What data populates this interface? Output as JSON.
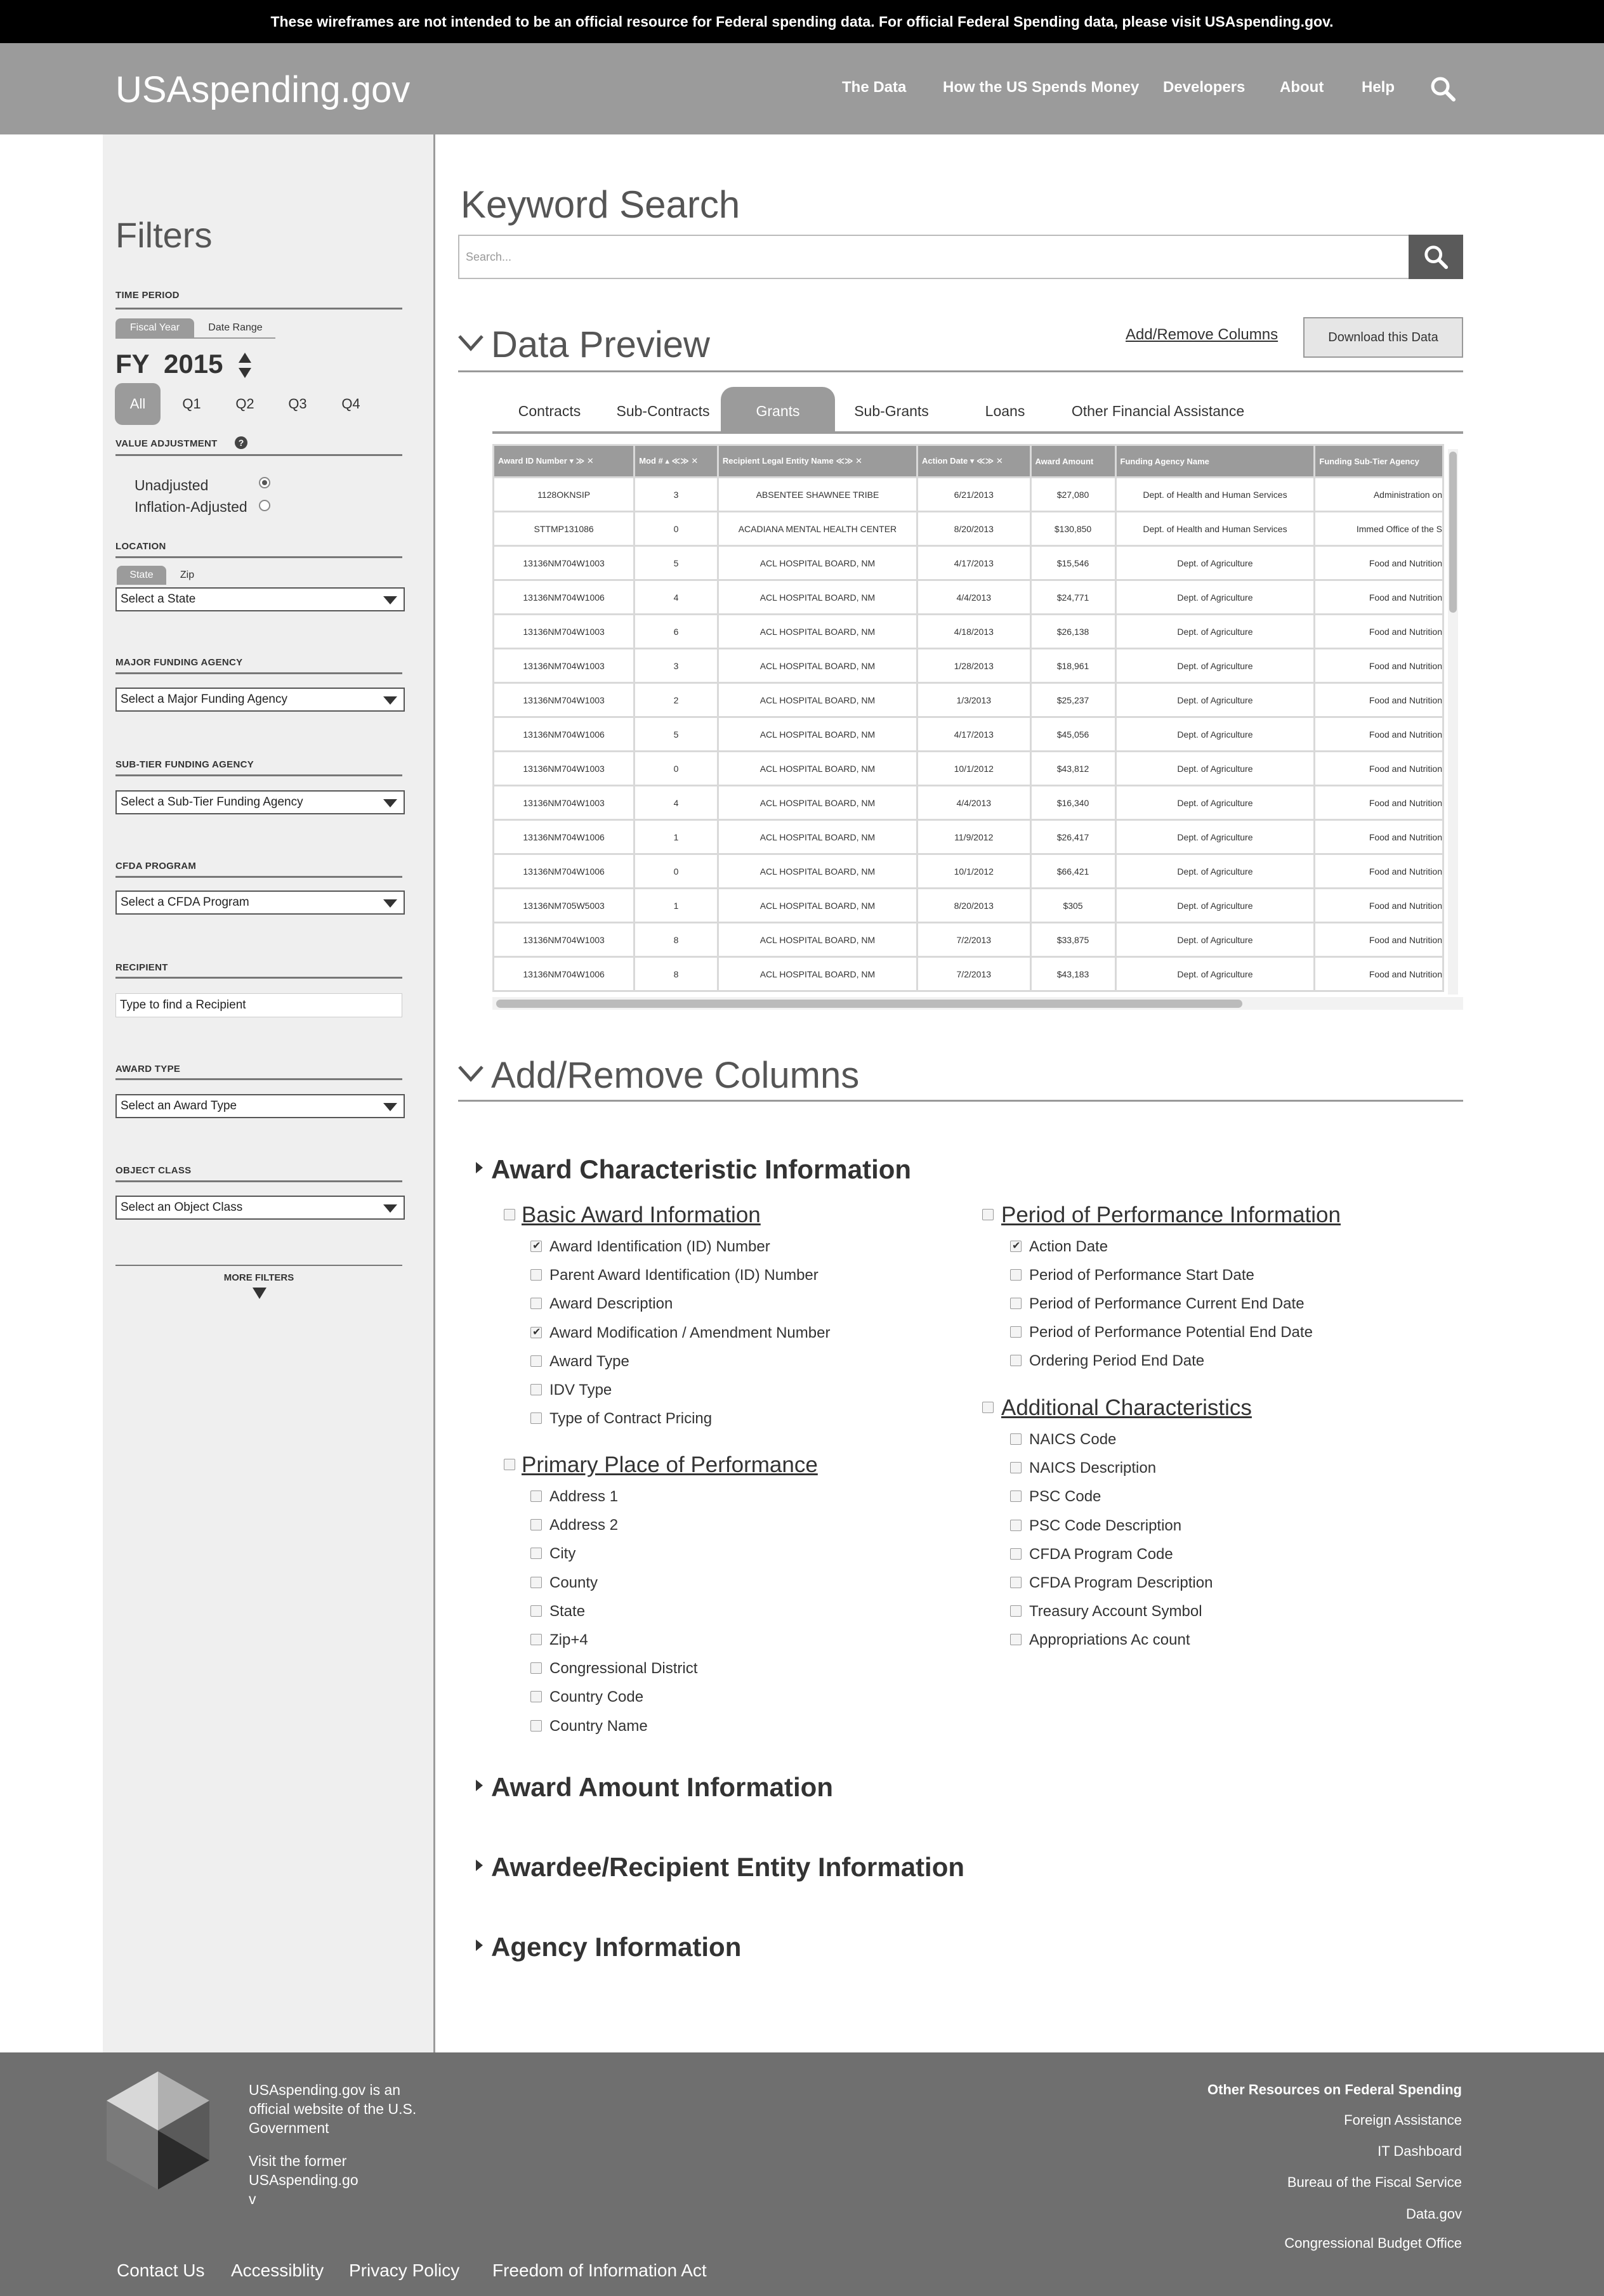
{
  "disclaimer": "These wireframes are not intended to be an official resource for Federal spending data. For official Federal Spending data, please visit USAspending.gov.",
  "header": {
    "brand": "USAspending.gov",
    "nav": [
      "The Data",
      "How the US Spends Money",
      "Developers",
      "About",
      "Help"
    ]
  },
  "filters": {
    "title": "Filters",
    "time_period": {
      "label": "TIME PERIOD",
      "tabs": [
        "Fiscal Year",
        "Date Range"
      ],
      "fy_label": "FY",
      "year": "2015",
      "quarters": [
        "All",
        "Q1",
        "Q2",
        "Q3",
        "Q4"
      ],
      "selected_quarter": "All"
    },
    "value_adjustment": {
      "label": "VALUE ADJUSTMENT",
      "help": "?",
      "options": [
        "Unadjusted",
        "Inflation-Adjusted"
      ],
      "selected": "Unadjusted"
    },
    "location": {
      "label": "LOCATION",
      "tabs": [
        "State",
        "Zip"
      ],
      "select": "Select a State"
    },
    "major_funding_agency": {
      "label": "MAJOR FUNDING AGENCY",
      "select": "Select a Major Funding Agency"
    },
    "sub_tier_funding_agency": {
      "label": "SUB-TIER FUNDING AGENCY",
      "select": "Select a Sub-Tier Funding Agency"
    },
    "cfda_program": {
      "label": "CFDA PROGRAM",
      "select": "Select a CFDA Program"
    },
    "recipient": {
      "label": "RECIPIENT",
      "placeholder": "Type to find a Recipient"
    },
    "award_type": {
      "label": "AWARD TYPE",
      "select": "Select an Award Type"
    },
    "object_class": {
      "label": "OBJECT CLASS",
      "select": "Select an Object Class"
    },
    "more_filters": "MORE FILTERS"
  },
  "keyword_search": {
    "title": "Keyword Search",
    "placeholder": "Search..."
  },
  "data_preview": {
    "title": "Data Preview",
    "add_remove_link": "Add/Remove Columns",
    "download_button": "Download this Data",
    "tabs": [
      "Contracts",
      "Sub-Contracts",
      "Grants",
      "Sub-Grants",
      "Loans",
      "Other Financial Assistance"
    ],
    "active_tab": "Grants",
    "columns": [
      "Award ID Number",
      "Mod #",
      "Recipient Legal Entity Name",
      "Action Date",
      "Award Amount",
      "Funding Agency Name",
      "Funding Sub-Tier Agency"
    ],
    "rows": [
      [
        "1128OKNSIP",
        "3",
        "ABSENTEE SHAWNEE TRIBE",
        "6/21/2013",
        "$27,080",
        "Dept. of Health and Human Services",
        "Administration on"
      ],
      [
        "STTMP131086",
        "0",
        "ACADIANA MENTAL HEALTH CENTER",
        "8/20/2013",
        "$130,850",
        "Dept. of Health and Human Services",
        "Immed Office of the S"
      ],
      [
        "13136NM704W1003",
        "5",
        "ACL HOSPITAL BOARD, NM",
        "4/17/2013",
        "$15,546",
        "Dept. of Agriculture",
        "Food and Nutrition"
      ],
      [
        "13136NM704W1006",
        "4",
        "ACL HOSPITAL BOARD, NM",
        "4/4/2013",
        "$24,771",
        "Dept. of Agriculture",
        "Food and Nutrition"
      ],
      [
        "13136NM704W1003",
        "6",
        "ACL HOSPITAL BOARD, NM",
        "4/18/2013",
        "$26,138",
        "Dept. of Agriculture",
        "Food and Nutrition"
      ],
      [
        "13136NM704W1003",
        "3",
        "ACL HOSPITAL BOARD, NM",
        "1/28/2013",
        "$18,961",
        "Dept. of Agriculture",
        "Food and Nutrition"
      ],
      [
        "13136NM704W1003",
        "2",
        "ACL HOSPITAL BOARD, NM",
        "1/3/2013",
        "$25,237",
        "Dept. of Agriculture",
        "Food and Nutrition"
      ],
      [
        "13136NM704W1006",
        "5",
        "ACL HOSPITAL BOARD, NM",
        "4/17/2013",
        "$45,056",
        "Dept. of Agriculture",
        "Food and Nutrition"
      ],
      [
        "13136NM704W1003",
        "0",
        "ACL HOSPITAL BOARD, NM",
        "10/1/2012",
        "$43,812",
        "Dept. of Agriculture",
        "Food and Nutrition"
      ],
      [
        "13136NM704W1003",
        "4",
        "ACL HOSPITAL BOARD, NM",
        "4/4/2013",
        "$16,340",
        "Dept. of Agriculture",
        "Food and Nutrition"
      ],
      [
        "13136NM704W1006",
        "1",
        "ACL HOSPITAL BOARD, NM",
        "11/9/2012",
        "$26,417",
        "Dept. of Agriculture",
        "Food and Nutrition"
      ],
      [
        "13136NM704W1006",
        "0",
        "ACL HOSPITAL BOARD, NM",
        "10/1/2012",
        "$66,421",
        "Dept. of Agriculture",
        "Food and Nutrition"
      ],
      [
        "13136NM705W5003",
        "1",
        "ACL HOSPITAL BOARD, NM",
        "8/20/2013",
        "$305",
        "Dept. of Agriculture",
        "Food and Nutrition"
      ],
      [
        "13136NM704W1003",
        "8",
        "ACL HOSPITAL BOARD, NM",
        "7/2/2013",
        "$33,875",
        "Dept. of Agriculture",
        "Food and Nutrition"
      ],
      [
        "13136NM704W1006",
        "8",
        "ACL HOSPITAL BOARD, NM",
        "7/2/2013",
        "$43,183",
        "Dept. of Agriculture",
        "Food and Nutrition"
      ]
    ]
  },
  "add_remove": {
    "title": "Add/Remove Columns",
    "award_characteristic": {
      "title": "Award Characteristic Information",
      "basic": {
        "title": "Basic Award Information",
        "items": [
          {
            "label": "Award Identification (ID) Number",
            "checked": true
          },
          {
            "label": "Parent Award Identification (ID) Number",
            "checked": false
          },
          {
            "label": "Award Description",
            "checked": false
          },
          {
            "label": "Award Modification / Amendment Number",
            "checked": true
          },
          {
            "label": "Award Type",
            "checked": false
          },
          {
            "label": "IDV Type",
            "checked": false
          },
          {
            "label": "Type of Contract Pricing",
            "checked": false
          }
        ]
      },
      "primary_place": {
        "title": "Primary Place of Performance",
        "items": [
          {
            "label": "Address 1",
            "checked": false
          },
          {
            "label": "Address 2",
            "checked": false
          },
          {
            "label": "City",
            "checked": false
          },
          {
            "label": "County",
            "checked": false
          },
          {
            "label": "State",
            "checked": false
          },
          {
            "label": "Zip+4",
            "checked": false
          },
          {
            "label": "Congressional District",
            "checked": false
          },
          {
            "label": "Country Code",
            "checked": false
          },
          {
            "label": "Country Name",
            "checked": false
          }
        ]
      },
      "period": {
        "title": "Period of Performance Information",
        "items": [
          {
            "label": "Action Date",
            "checked": true
          },
          {
            "label": "Period of Performance Start Date",
            "checked": false
          },
          {
            "label": "Period of Performance Current End Date",
            "checked": false
          },
          {
            "label": "Period of Performance Potential End Date",
            "checked": false
          },
          {
            "label": "Ordering Period End Date",
            "checked": false
          }
        ]
      },
      "additional": {
        "title": "Additional Characteristics",
        "items": [
          {
            "label": "NAICS Code",
            "checked": false
          },
          {
            "label": "NAICS Description",
            "checked": false
          },
          {
            "label": "PSC Code",
            "checked": false
          },
          {
            "label": "PSC Code Description",
            "checked": false
          },
          {
            "label": "CFDA Program Code",
            "checked": false
          },
          {
            "label": "CFDA Program Description",
            "checked": false
          },
          {
            "label": "Treasury Account Symbol",
            "checked": false
          },
          {
            "label": "Appropriations Ac count",
            "checked": false
          }
        ]
      }
    },
    "award_amount": "Award Amount Information",
    "awardee": "Awardee/Recipient Entity Information",
    "agency": "Agency Information"
  },
  "footer": {
    "official_line1": "USAspending.gov is an",
    "official_line2": "official website of the U.S.",
    "official_line3": "Government",
    "former_line1": "Visit the former",
    "former_line2": "USAspending.go",
    "former_line3": "v",
    "resources_title": "Other Resources on Federal Spending",
    "resources": [
      "Foreign Assistance",
      "IT Dashboard",
      "Bureau of the Fiscal Service",
      "Data.gov",
      "Congressional Budget Office"
    ],
    "links": [
      "Contact Us",
      "Accessiblity",
      "Privacy Policy",
      "Freedom of Information Act"
    ]
  }
}
